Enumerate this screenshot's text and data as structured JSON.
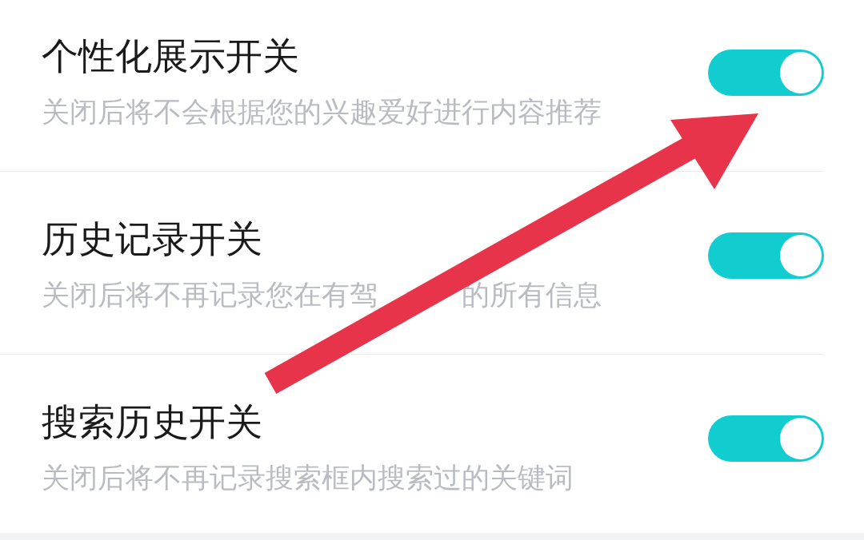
{
  "settings": [
    {
      "title": "个性化展示开关",
      "description": [
        "关闭后将不会根据您的兴趣爱好进行内容推荐"
      ],
      "on": true
    },
    {
      "title": "历史记录开关",
      "description": [
        "关闭后将不再记录您在有驾",
        "的所有信息"
      ],
      "on": true
    },
    {
      "title": "搜索历史开关",
      "description": [
        "关闭后将不再记录搜索框内搜索过的关键词"
      ],
      "on": true
    }
  ],
  "annotation": {
    "kind": "arrow"
  }
}
